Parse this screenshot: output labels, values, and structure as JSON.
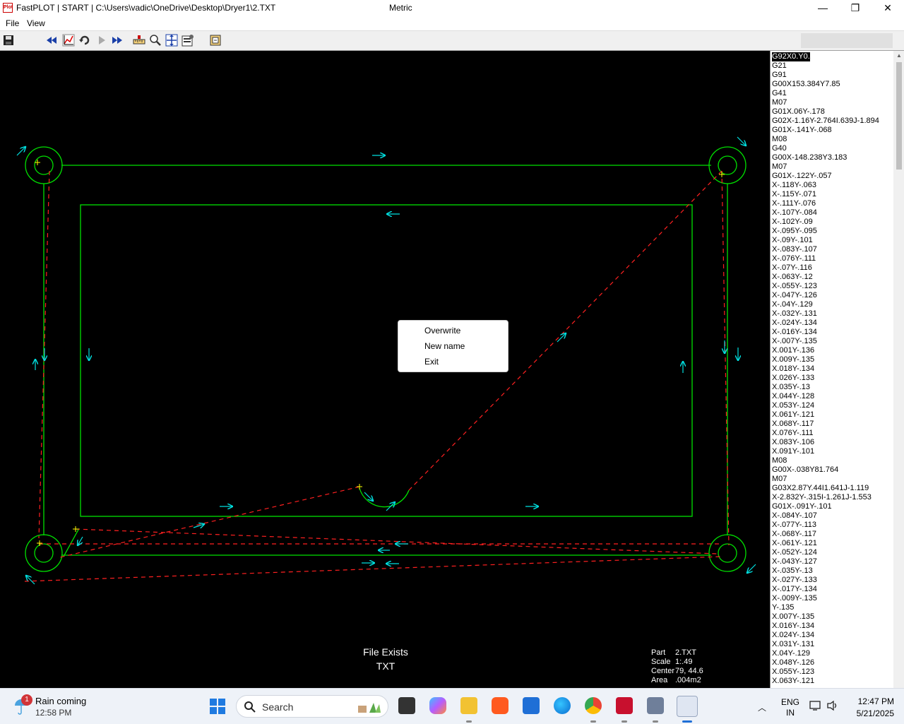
{
  "window": {
    "app_name": "FastPLOT",
    "mode": "START",
    "file_path": "C:\\Users\\vadic\\OneDrive\\Desktop\\Dryer1\\2.TXT",
    "units": "Metric",
    "icon_text": "Plot",
    "minimize": "—",
    "maximize": "❐",
    "close": "✕"
  },
  "menu": {
    "file": "File",
    "view": "View"
  },
  "toolbar": {
    "icons": [
      "save-icon",
      "rewind-icon",
      "plot-icon",
      "reset-icon",
      "play-icon",
      "fast-forward-icon",
      "ruler-icon",
      "zoom-icon",
      "fit-icon",
      "settings-icon",
      "export-icon"
    ]
  },
  "gcode": {
    "selected_index": 0,
    "lines": [
      "G92X0.Y0.",
      "G21",
      "G91",
      "G00X153.384Y7.85",
      "G41",
      "M07",
      "G01X.06Y-.178",
      "G02X-1.16Y-2.764I.639J-1.894",
      "G01X-.141Y-.068",
      "M08",
      "G40",
      "G00X-148.238Y3.183",
      "M07",
      "G01X-.122Y-.057",
      "X-.118Y-.063",
      "X-.115Y-.071",
      "X-.111Y-.076",
      "X-.107Y-.084",
      "X-.102Y-.09",
      "X-.095Y-.095",
      "X-.09Y-.101",
      "X-.083Y-.107",
      "X-.076Y-.111",
      "X-.07Y-.116",
      "X-.063Y-.12",
      "X-.055Y-.123",
      "X-.047Y-.126",
      "X-.04Y-.129",
      "X-.032Y-.131",
      "X-.024Y-.134",
      "X-.016Y-.134",
      "X-.007Y-.135",
      "X.001Y-.136",
      "X.009Y-.135",
      "X.018Y-.134",
      "X.026Y-.133",
      "X.035Y-.13",
      "X.044Y-.128",
      "X.053Y-.124",
      "X.061Y-.121",
      "X.068Y-.117",
      "X.076Y-.111",
      "X.083Y-.106",
      "X.091Y-.101",
      "M08",
      "G00X-.038Y81.764",
      "M07",
      "G03X2.87Y.44I1.641J-1.119",
      "X-2.832Y-.315I-1.261J-1.553",
      "G01X-.091Y-.101",
      "X-.084Y-.107",
      "X-.077Y-.113",
      "X-.068Y-.117",
      "X-.061Y-.121",
      "X-.052Y-.124",
      "X-.043Y-.127",
      "X-.035Y-.13",
      "X-.027Y-.133",
      "X-.017Y-.134",
      "X-.009Y-.135",
      "Y-.135",
      "X.007Y-.135",
      "X.016Y-.134",
      "X.024Y-.134",
      "X.031Y-.131",
      "X.04Y-.129",
      "X.048Y-.126",
      "X.055Y-.123",
      "X.063Y-.121"
    ]
  },
  "popup_menu": {
    "items": [
      "Overwrite",
      "New name",
      "Exit"
    ]
  },
  "canvas": {
    "status_line1": "File Exists",
    "status_line2": "TXT",
    "info": {
      "part_label": "Part",
      "part_value": "2.TXT",
      "scale_label": "Scale",
      "scale_value": "1:.49",
      "center_label": "Center",
      "center_value": "79, 44.6",
      "area_label": "Area",
      "area_value": ".004m2"
    },
    "colors": {
      "profile": "#00e000",
      "rapid": "#ff2020",
      "arrow": "#00e0e0",
      "background": "#000000"
    }
  },
  "taskbar": {
    "weather_title": "Rain coming",
    "weather_time": "12:58 PM",
    "badge": "1",
    "search_placeholder": "Search",
    "lang_top": "ENG",
    "lang_bottom": "IN",
    "time": "12:47 PM",
    "date": "5/21/2025",
    "apps": [
      "start-icon",
      "file-explorer-icon",
      "copilot-icon",
      "folder-icon",
      "brave-icon",
      "store-icon",
      "edge-icon",
      "chrome-icon",
      "solidworks-icon",
      "fastcam-icon",
      "fastplot-icon"
    ]
  }
}
